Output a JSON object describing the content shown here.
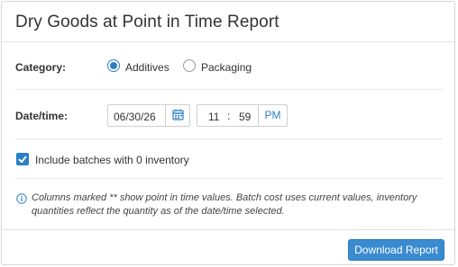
{
  "dialog": {
    "title": "Dry Goods at Point in Time Report"
  },
  "category": {
    "label": "Category:",
    "options": [
      {
        "label": "Additives",
        "selected": true
      },
      {
        "label": "Packaging",
        "selected": false
      }
    ]
  },
  "datetime": {
    "label": "Date/time:",
    "date": "06/30/26",
    "hour": "11",
    "separator": ":",
    "minute": "59",
    "ampm": "PM",
    "calendar_icon": "calendar-icon"
  },
  "include_zero": {
    "label": "Include batches with 0 inventory",
    "checked": true
  },
  "note": {
    "icon": "info-icon",
    "text": "Columns marked ** show point in time values. Batch cost uses current values, inventory quantities reflect the quantity as of the date/time selected."
  },
  "footer": {
    "download_label": "Download Report"
  },
  "colors": {
    "accent": "#2a7fc4",
    "button": "#3a8bd0"
  }
}
